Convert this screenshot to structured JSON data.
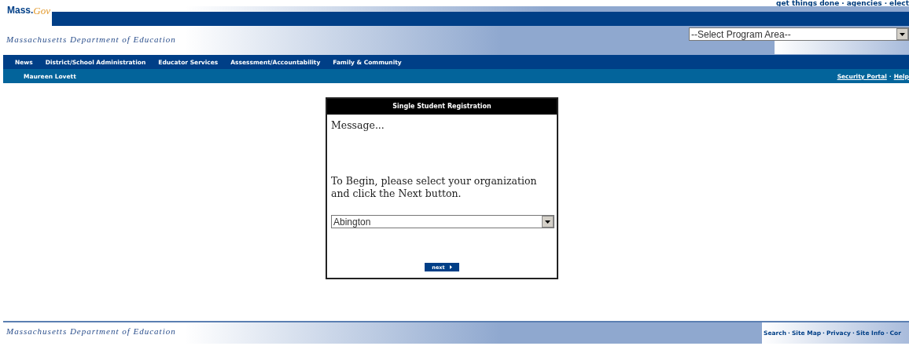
{
  "header": {
    "logo_main": "Mass.",
    "logo_script": "Gov",
    "top_links": [
      "get things done",
      "agencies",
      "elect"
    ],
    "separator": "·",
    "site_title": "Massachusetts Department of Education",
    "program_select": {
      "value": "--Select Program Area--"
    }
  },
  "nav": {
    "items": [
      "News",
      "District/School Administration",
      "Educator Services",
      "Assessment/Accountability",
      "Family & Community"
    ]
  },
  "user_bar": {
    "user": "Maureen Lovett",
    "links": [
      "Security Portal",
      "Help"
    ]
  },
  "dialog": {
    "title": "Single Student Registration",
    "message": "Message...",
    "instruction": "To Begin, please select your organization and click the Next button.",
    "organization_select": {
      "value": "Abington"
    },
    "next_button": "next"
  },
  "footer": {
    "site_title": "Massachusetts Department of Education",
    "links": [
      "Search",
      "Site Map",
      "Privacy",
      "Site Info",
      "Cor"
    ]
  }
}
